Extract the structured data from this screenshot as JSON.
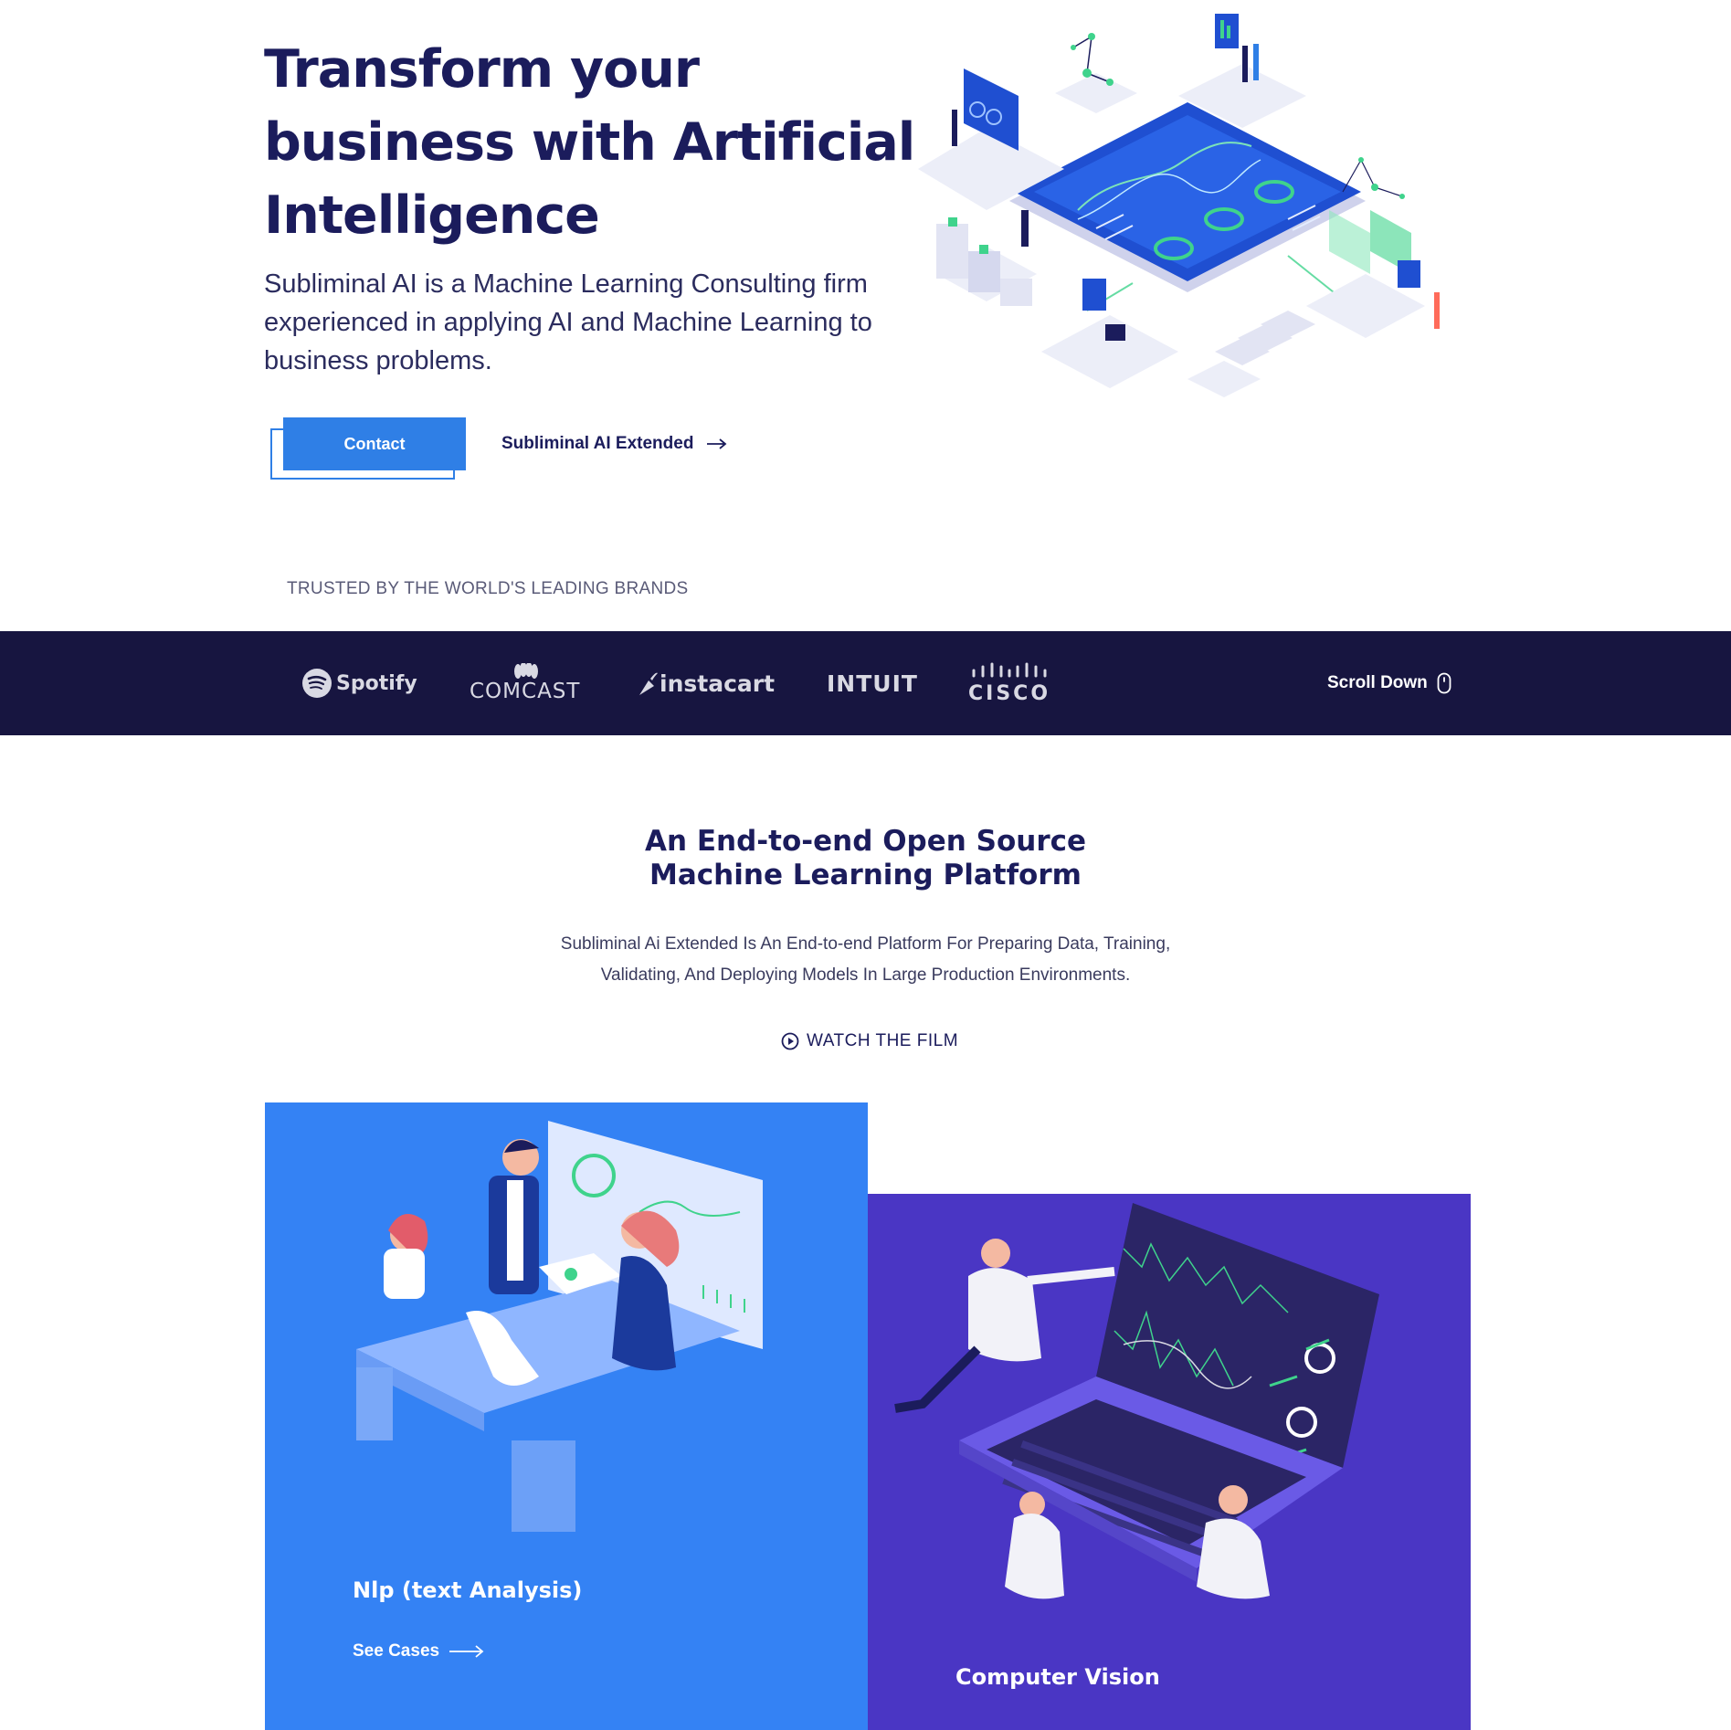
{
  "hero": {
    "title": "Transform your business with Artificial Intelligence",
    "subtitle": "Subliminal AI is a Machine Learning Consulting firm experienced in applying AI and Machine Learning to business problems.",
    "contact_label": "Contact",
    "extended_label": "Subliminal AI Extended"
  },
  "trusted": {
    "label": "TRUSTED BY THE WORLD'S LEADING BRANDS",
    "brands": [
      "Spotify",
      "COMCAST",
      "instacart",
      "INTUIT",
      "CISCO"
    ],
    "scroll_label": "Scroll Down"
  },
  "platform": {
    "title_line1": "An End-to-end Open Source",
    "title_line2": "Machine Learning Platform",
    "desc_line1": "Subliminal Ai Extended Is An End-to-end Platform For Preparing Data, Training,",
    "desc_line2": "Validating, And Deploying Models In Large Production Environments.",
    "watch_label": "WATCH THE FILM"
  },
  "cards": [
    {
      "title": "Nlp (text Analysis)",
      "link": "See Cases"
    },
    {
      "title": "Computer Vision"
    }
  ],
  "colors": {
    "navy": "#1b1c5c",
    "accent_blue": "#2f7fe6",
    "brand_bar": "#171540",
    "card_blue": "#3482f4",
    "card_purple": "#4a36c4",
    "green": "#2bd17e"
  }
}
